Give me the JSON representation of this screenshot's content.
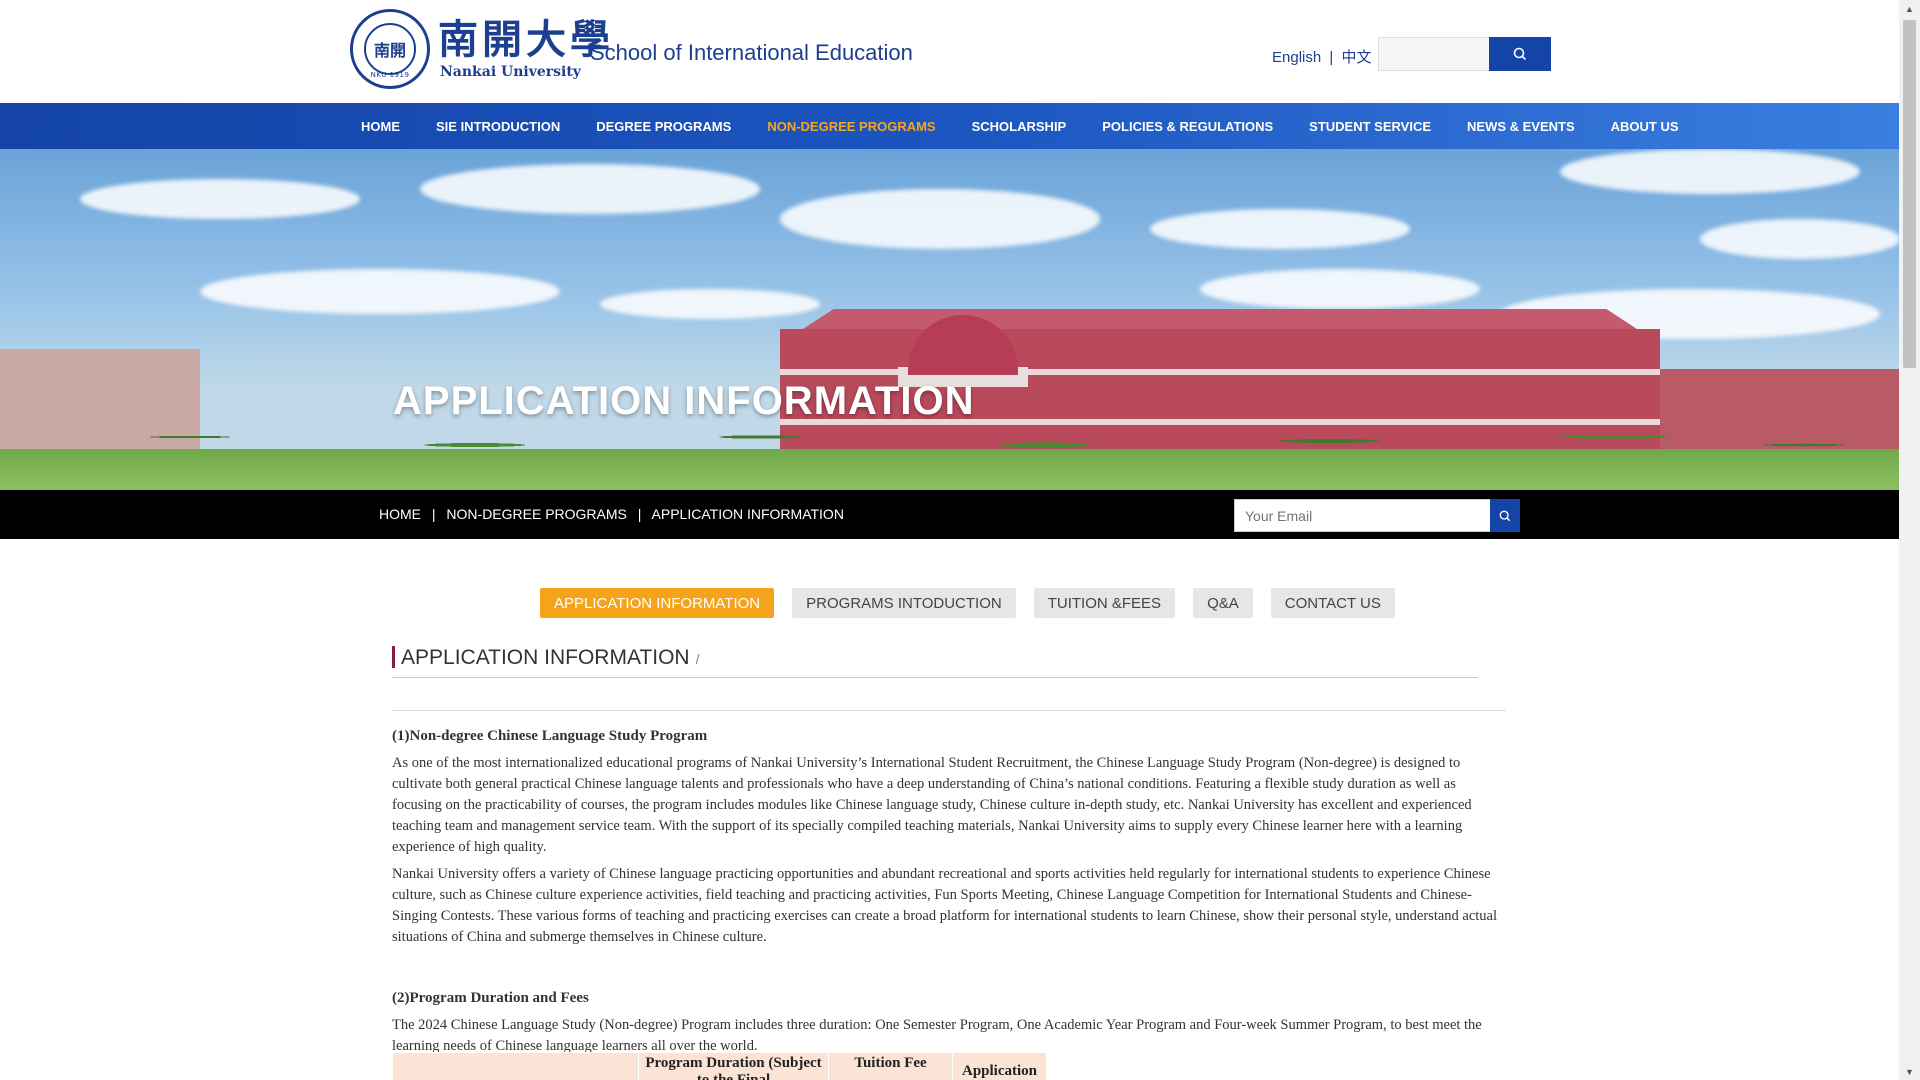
{
  "header": {
    "logo_cn": "南開大學",
    "logo_en": "Nankai University",
    "logo_seal_text": "NKU 1919",
    "site_title": "School of International Education",
    "lang_en": "English",
    "lang_sep": "|",
    "lang_cn": "中文",
    "search_icon": "search-icon"
  },
  "nav": {
    "items": [
      {
        "label": "HOME"
      },
      {
        "label": "SIE INTRODUCTION"
      },
      {
        "label": "DEGREE PROGRAMS"
      },
      {
        "label": "NON-DEGREE PROGRAMS",
        "active": true
      },
      {
        "label": "SCHOLARSHIP"
      },
      {
        "label": "POLICIES & REGULATIONS"
      },
      {
        "label": "STUDENT SERVICE"
      },
      {
        "label": "NEWS & EVENTS"
      },
      {
        "label": "ABOUT US"
      }
    ],
    "active_color": "#f5a623"
  },
  "banner": {
    "title": "APPLICATION INFORMATION"
  },
  "breadcrumb": {
    "items": [
      "HOME",
      "NON-DEGREE PROGRAMS",
      "APPLICATION INFORMATION"
    ],
    "sep": "|",
    "email_placeholder": "Your Email"
  },
  "tabs": [
    {
      "label": "APPLICATION INFORMATION",
      "active": true
    },
    {
      "label": "PROGRAMS INTODUCTION"
    },
    {
      "label": "TUITION &FEES"
    },
    {
      "label": "Q&A"
    },
    {
      "label": "CONTACT US"
    }
  ],
  "section": {
    "title": "APPLICATION INFORMATION",
    "slash": "/"
  },
  "content": {
    "h1": "(1)Non-degree Chinese Language Study Program",
    "p1": "As one of the most internationalized educational programs of Nankai University’s International Student Recruitment, the Chinese Language Study Program (Non-degree) is designed to cultivate both general practical Chinese language talents and professionals who have a deep understanding of China’s national conditions. Featuring a flexible study duration as well as focusing on the practicability of courses, the program includes modules like Chinese language study, Chinese culture in-depth study, etc. Nankai University has excellent and experienced teaching team and management service team. With the support of its specially compiled teaching materials, Nankai University aims to supply every Chinese learner here with a learning experience of high quality.",
    "p2": "Nankai University offers a variety of Chinese language practicing opportunities and abundant recreational and sports activities held regularly for international students to experience Chinese culture, such as Chinese culture experience activities, field teaching and practicing activities, Fun Sports Meeting, Chinese Language Competition for International Students and Chinese-Singing Contests. These various forms of teaching and practicing exercises can create a broad platform for international students to learn Chinese, show their personal style, understand actual situations of China and submerge themselves in Chinese culture.",
    "h2": "(2)Program Duration and Fees",
    "p3": "The 2024 Chinese Language Study (Non-degree) Program includes three duration: One Semester Program, One Academic Year Program and Four-week Summer Program, to best meet the learning needs of Chinese language learners all over the world."
  },
  "table": {
    "headers": [
      "",
      "Program Duration (Subject to the Final",
      "Tuition Fee",
      "Application"
    ]
  },
  "colors": {
    "brand_blue": "#1444a8",
    "tab_active": "#f5a31b",
    "accent_bar": "#8b1a4b"
  }
}
